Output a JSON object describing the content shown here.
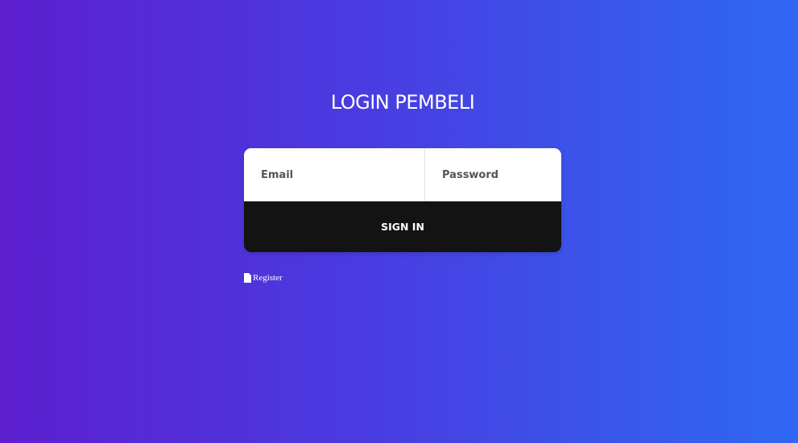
{
  "page": {
    "title": "LOGIN PEMBELI"
  },
  "form": {
    "email_placeholder": "Email",
    "password_placeholder": "Password",
    "submit_label": "SIGN IN"
  },
  "links": {
    "register_label": "Register",
    "register_icon": "file-icon"
  },
  "colors": {
    "gradient_start": "#5d1fcf",
    "gradient_end": "#2f68f2",
    "button_bg": "#131313",
    "text_light": "#ffffff"
  }
}
